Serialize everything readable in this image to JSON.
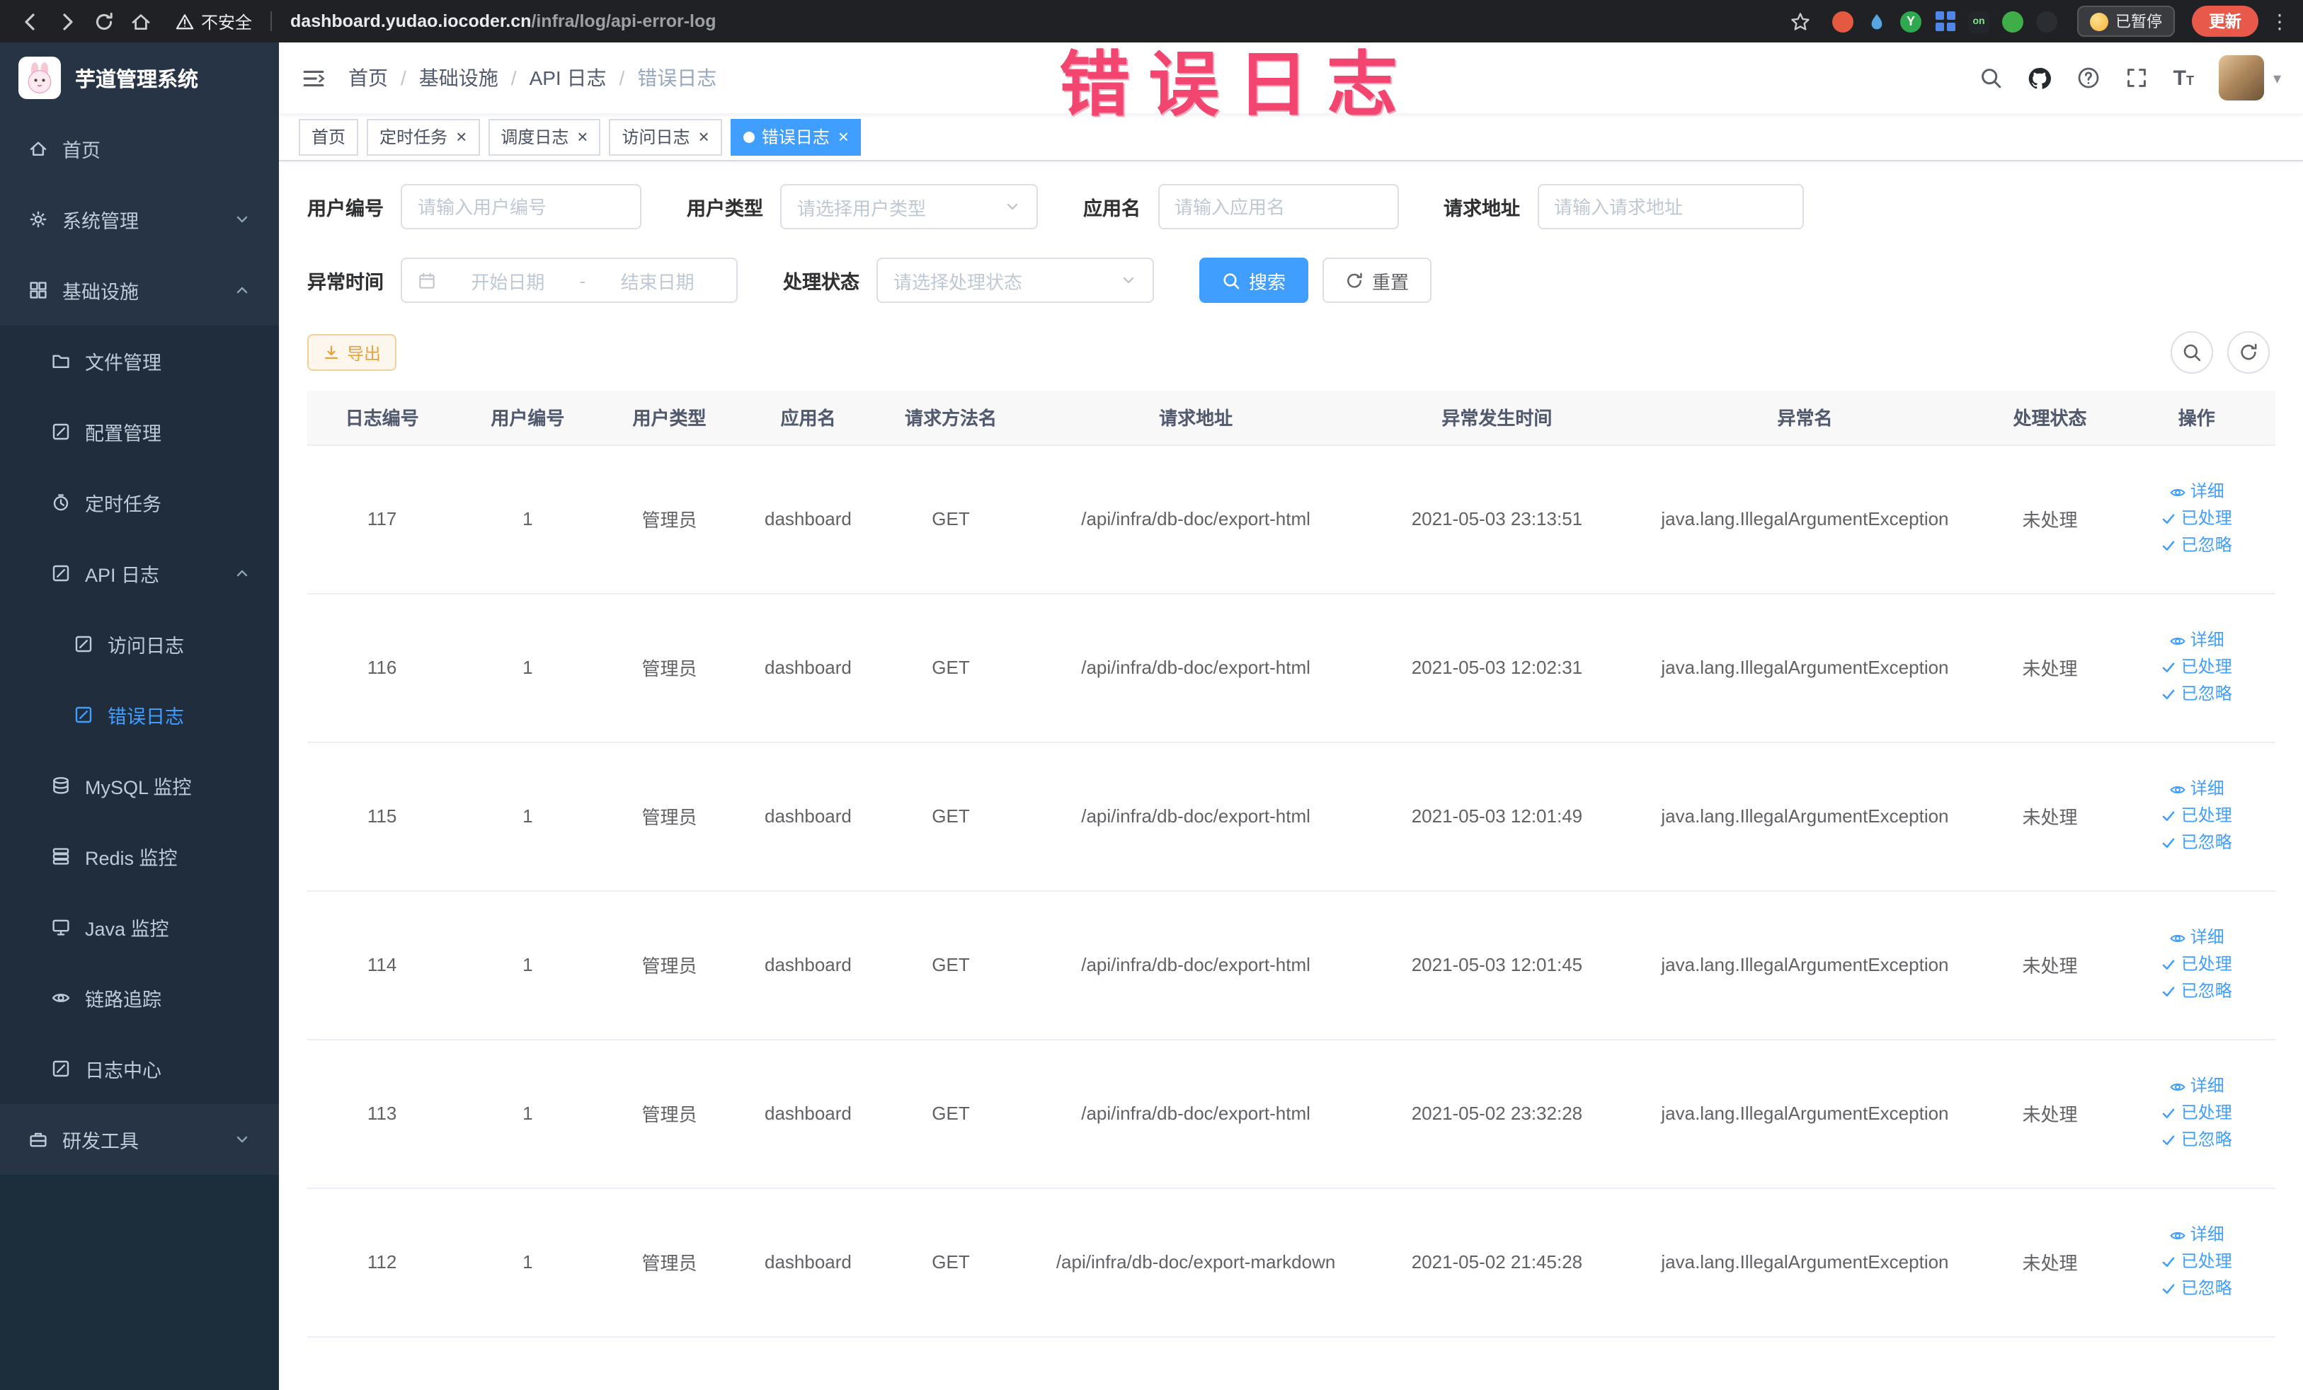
{
  "browser": {
    "security_label": "不安全",
    "url_domain": "dashboard.yudao.iocoder.cn",
    "url_path": "/infra/log/api-error-log",
    "paused_badge": "已暂停",
    "update_button": "更新",
    "kebab_glyph": "⋮"
  },
  "watermark": {
    "text": "错误日志",
    "color": "#f2456f"
  },
  "sidebar": {
    "logo_title": "芋道管理系统",
    "items": [
      {
        "key": "home",
        "label": "首页",
        "level": 0,
        "icon": "home"
      },
      {
        "key": "system-management",
        "label": "系统管理",
        "level": 0,
        "icon": "gear",
        "chevron": "down"
      },
      {
        "key": "infrastructure",
        "label": "基础设施",
        "level": 0,
        "icon": "grid",
        "chevron": "up"
      },
      {
        "key": "file-management",
        "label": "文件管理",
        "level": 1,
        "icon": "folder",
        "sub": true
      },
      {
        "key": "config-management",
        "label": "配置管理",
        "level": 1,
        "icon": "edit",
        "sub": true
      },
      {
        "key": "scheduled-tasks",
        "label": "定时任务",
        "level": 1,
        "icon": "timer",
        "sub": true
      },
      {
        "key": "api-logs",
        "label": "API 日志",
        "level": 1,
        "icon": "edit",
        "chevron": "up",
        "sub": true
      },
      {
        "key": "access-log",
        "label": "访问日志",
        "level": 2,
        "icon": "edit",
        "sub": true
      },
      {
        "key": "error-log",
        "label": "错误日志",
        "level": 2,
        "icon": "edit",
        "sub": true,
        "active": true
      },
      {
        "key": "mysql-monitor",
        "label": "MySQL 监控",
        "level": 1,
        "icon": "db",
        "sub": true
      },
      {
        "key": "redis-monitor",
        "label": "Redis 监控",
        "level": 1,
        "icon": "layers",
        "sub": true
      },
      {
        "key": "java-monitor",
        "label": "Java 监控",
        "level": 1,
        "icon": "monitor",
        "sub": true
      },
      {
        "key": "link-tracing",
        "label": "链路追踪",
        "level": 1,
        "icon": "eye",
        "sub": true
      },
      {
        "key": "log-center",
        "label": "日志中心",
        "level": 1,
        "icon": "edit",
        "sub": true
      },
      {
        "key": "dev-tools",
        "label": "研发工具",
        "level": 0,
        "icon": "toolbox",
        "chevron": "down"
      }
    ]
  },
  "header": {
    "breadcrumb": [
      "首页",
      "基础设施",
      "API 日志",
      "错误日志"
    ]
  },
  "tabs": [
    {
      "label": "首页",
      "closable": false,
      "active": false
    },
    {
      "label": "定时任务",
      "closable": true,
      "active": false
    },
    {
      "label": "调度日志",
      "closable": true,
      "active": false
    },
    {
      "label": "访问日志",
      "closable": true,
      "active": false
    },
    {
      "label": "错误日志",
      "closable": true,
      "active": true
    }
  ],
  "filters": {
    "user_id": {
      "label": "用户编号",
      "placeholder": "请输入用户编号"
    },
    "user_type": {
      "label": "用户类型",
      "placeholder": "请选择用户类型"
    },
    "app_name": {
      "label": "应用名",
      "placeholder": "请输入应用名"
    },
    "request_url": {
      "label": "请求地址",
      "placeholder": "请输入请求地址"
    },
    "exception_time": {
      "label": "异常时间",
      "start_placeholder": "开始日期",
      "separator": "-",
      "end_placeholder": "结束日期"
    },
    "process_status": {
      "label": "处理状态",
      "placeholder": "请选择处理状态"
    },
    "search_button": "搜索",
    "reset_button": "重置"
  },
  "toolbar": {
    "export_button": "导出"
  },
  "table": {
    "headers": [
      "日志编号",
      "用户编号",
      "用户类型",
      "应用名",
      "请求方法名",
      "请求地址",
      "异常发生时间",
      "异常名",
      "处理状态",
      "操作"
    ],
    "row_actions": [
      "详细",
      "已处理",
      "已忽略"
    ],
    "rows": [
      {
        "id": "117",
        "user_id": "1",
        "user_type": "管理员",
        "app": "dashboard",
        "method": "GET",
        "url": "/api/infra/db-doc/export-html",
        "time": "2021-05-03 23:13:51",
        "exception": "java.lang.IllegalArgumentException",
        "status": "未处理"
      },
      {
        "id": "116",
        "user_id": "1",
        "user_type": "管理员",
        "app": "dashboard",
        "method": "GET",
        "url": "/api/infra/db-doc/export-html",
        "time": "2021-05-03 12:02:31",
        "exception": "java.lang.IllegalArgumentException",
        "status": "未处理"
      },
      {
        "id": "115",
        "user_id": "1",
        "user_type": "管理员",
        "app": "dashboard",
        "method": "GET",
        "url": "/api/infra/db-doc/export-html",
        "time": "2021-05-03 12:01:49",
        "exception": "java.lang.IllegalArgumentException",
        "status": "未处理"
      },
      {
        "id": "114",
        "user_id": "1",
        "user_type": "管理员",
        "app": "dashboard",
        "method": "GET",
        "url": "/api/infra/db-doc/export-html",
        "time": "2021-05-03 12:01:45",
        "exception": "java.lang.IllegalArgumentException",
        "status": "未处理"
      },
      {
        "id": "113",
        "user_id": "1",
        "user_type": "管理员",
        "app": "dashboard",
        "method": "GET",
        "url": "/api/infra/db-doc/export-html",
        "time": "2021-05-02 23:32:28",
        "exception": "java.lang.IllegalArgumentException",
        "status": "未处理"
      },
      {
        "id": "112",
        "user_id": "1",
        "user_type": "管理员",
        "app": "dashboard",
        "method": "GET",
        "url": "/api/infra/db-doc/export-markdown",
        "time": "2021-05-02 21:45:28",
        "exception": "java.lang.IllegalArgumentException",
        "status": "未处理"
      }
    ]
  },
  "colors": {
    "accent": "#409eff",
    "warning": "#e6a23c",
    "sidebar_bg": "#263445",
    "submenu_bg": "#1f2d3d"
  }
}
